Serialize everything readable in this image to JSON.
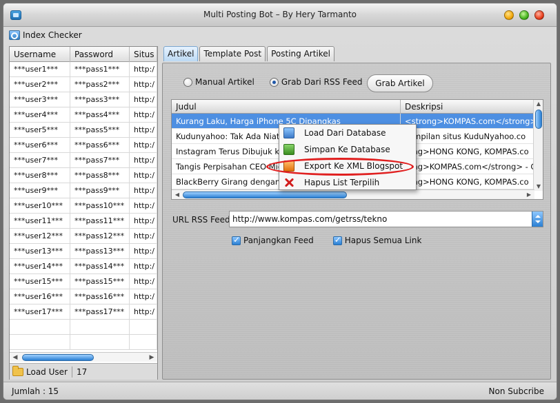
{
  "window": {
    "title": "Multi Posting Bot – By Hery Tarmanto"
  },
  "menu": {
    "index_checker": "Index Checker"
  },
  "left_table": {
    "headers": [
      "Username",
      "Password",
      "Situs"
    ],
    "rows": [
      [
        "***user1***",
        "***pass1***",
        "http:/"
      ],
      [
        "***user2***",
        "***pass2***",
        "http:/"
      ],
      [
        "***user3***",
        "***pass3***",
        "http:/"
      ],
      [
        "***user4***",
        "***pass4***",
        "http:/"
      ],
      [
        "***user5***",
        "***pass5***",
        "http:/"
      ],
      [
        "***user6***",
        "***pass6***",
        "http:/"
      ],
      [
        "***user7***",
        "***pass7***",
        "http:/"
      ],
      [
        "***user8***",
        "***pass8***",
        "http:/"
      ],
      [
        "***user9***",
        "***pass9***",
        "http:/"
      ],
      [
        "***user10***",
        "***pass10***",
        "http:/"
      ],
      [
        "***user11***",
        "***pass11***",
        "http:/"
      ],
      [
        "***user12***",
        "***pass12***",
        "http:/"
      ],
      [
        "***user13***",
        "***pass13***",
        "http:/"
      ],
      [
        "***user14***",
        "***pass14***",
        "http:/"
      ],
      [
        "***user15***",
        "***pass15***",
        "http:/"
      ],
      [
        "***user16***",
        "***pass16***",
        "http:/"
      ],
      [
        "***user17***",
        "***pass17***",
        "http:/"
      ],
      [
        "",
        "",
        ""
      ],
      [
        "",
        "",
        ""
      ]
    ],
    "footer": {
      "load_label": "Load User",
      "count": "17"
    }
  },
  "tabs": [
    {
      "label": "Artikel",
      "active": true
    },
    {
      "label": "Template Post",
      "active": false
    },
    {
      "label": "Posting Artikel",
      "active": false
    }
  ],
  "source": {
    "manual_label": "Manual Artikel",
    "rss_label": "Grab Dari RSS Feed",
    "selected": "rss",
    "grab_button": "Grab Artikel"
  },
  "articles": {
    "headers": [
      "Judul",
      "Deskripsi"
    ],
    "rows": [
      [
        "Kurang Laku, Harga iPhone 5C Dipangkas",
        "<strong>KOMPAS.com</strong>  D"
      ],
      [
        "Kudunyahoo: Tak Ada Niat",
        "Tampilan situs KuduNyahoo.co"
      ],
      [
        "Instagram Terus Dibujuk ke",
        "rong>HONG KONG, KOMPAS.co"
      ],
      [
        "Tangis Perpisahan CEO Mic",
        "rong>KOMPAS.com</strong> - C"
      ],
      [
        "BlackBerry Girang dengan A",
        "rong>HONG KONG, KOMPAS.co"
      ]
    ],
    "selected_index": 0
  },
  "context_menu": {
    "items": [
      {
        "label": "Load Dari Database",
        "icon": "database-icon"
      },
      {
        "label": "Simpan Ke Database",
        "icon": "save-icon"
      },
      {
        "label": "Export Ke XML Blogspot",
        "icon": "xml-export-icon"
      },
      {
        "label": "Hapus List Terpilih",
        "icon": "delete-icon"
      }
    ],
    "highlighted_index": 2
  },
  "rss": {
    "label": "URL RSS Feed",
    "url": "http://www.kompas.com/getrss/tekno"
  },
  "options": {
    "panjangkan_feed": "Panjangkan Feed",
    "hapus_semua_link": "Hapus Semua Link"
  },
  "status": {
    "left": "Jumlah : 15",
    "right": "Non Subcribe"
  }
}
